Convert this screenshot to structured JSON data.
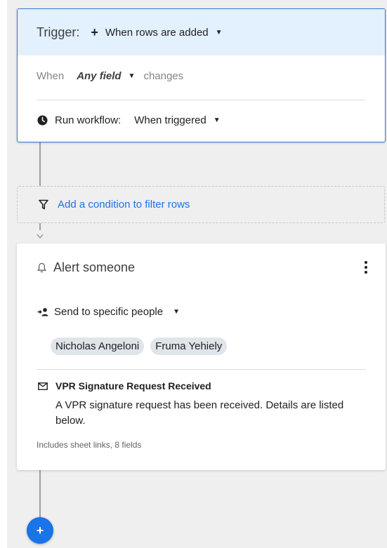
{
  "trigger": {
    "label": "Trigger:",
    "event_icon": "plus-glyph",
    "event_value": "When rows are added",
    "when_prefix": "When",
    "field_value": "Any field",
    "when_suffix": "changes",
    "run_icon": "clock-icon",
    "run_label": "Run workflow:",
    "run_value": "When triggered"
  },
  "filter": {
    "icon": "funnel-icon",
    "link_text": "Add a condition to filter rows"
  },
  "alert": {
    "icon": "bell-icon",
    "title": "Alert someone",
    "menu_icon": "more-vert-icon",
    "send_icon": "person-add-icon",
    "send_value": "Send to specific people",
    "recipients": [
      "Nicholas Angeloni",
      "Fruma Yehiely"
    ],
    "message": {
      "icon": "mail-icon",
      "title": "VPR Signature Request Received",
      "body": "A VPR signature request has been received. Details are listed below.",
      "meta": "Includes sheet links, 8 fields"
    }
  },
  "add_button": {
    "label": "+"
  },
  "colors": {
    "accent": "#1a73e8",
    "trigger_header_bg": "#e3f0fd",
    "trigger_border": "#2a7de1",
    "canvas_bg": "#efefef",
    "chip_bg": "#e0e5ea"
  }
}
